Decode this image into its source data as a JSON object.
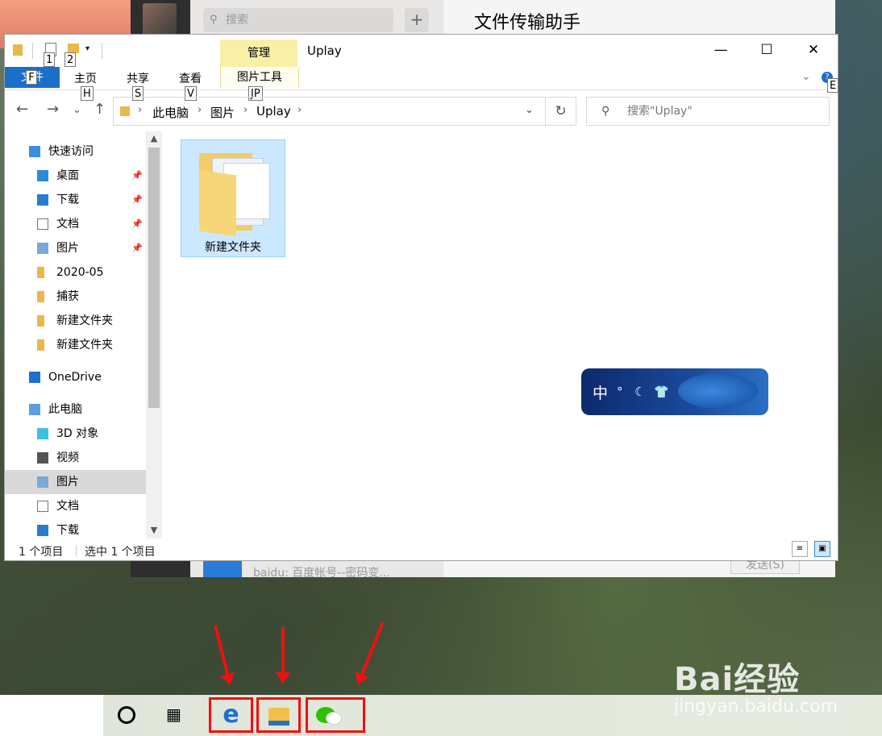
{
  "background_app": {
    "search_placeholder": "搜索",
    "plus": "+",
    "chat_title": "文件传输助手",
    "preview_text": "baidu: 百度帐号--密码变...",
    "send_button": "发送(S)"
  },
  "window": {
    "title": "Uplay",
    "context_tab": "管理",
    "quick_access_keytips": [
      "1",
      "2"
    ],
    "controls": {
      "minimize": "—",
      "maximize": "☐",
      "close": "✕"
    }
  },
  "ribbon": {
    "file_tab": "文件",
    "tabs": [
      "主页",
      "共享",
      "查看"
    ],
    "tools_tab": "图片工具",
    "keytips": {
      "file": "F",
      "home": "H",
      "share": "S",
      "view": "V",
      "tools": "JP",
      "help": "E"
    },
    "collapse": "⌄",
    "help": "?"
  },
  "navigation": {
    "back": "←",
    "forward": "→",
    "recent": "⌄",
    "up": "↑",
    "breadcrumb": [
      "此电脑",
      "图片",
      "Uplay"
    ],
    "search_placeholder": "搜索\"Uplay\""
  },
  "nav_pane": {
    "items": [
      {
        "label": "快速访问",
        "icon": "star-icon",
        "pinned": false
      },
      {
        "label": "桌面",
        "icon": "desktop-icon",
        "pinned": true
      },
      {
        "label": "下载",
        "icon": "download-icon",
        "pinned": true
      },
      {
        "label": "文档",
        "icon": "document-icon",
        "pinned": true
      },
      {
        "label": "图片",
        "icon": "pictures-icon",
        "pinned": true
      },
      {
        "label": "2020-05",
        "icon": "folder-icon",
        "pinned": false
      },
      {
        "label": "捕获",
        "icon": "folder-icon",
        "pinned": false
      },
      {
        "label": "新建文件夹",
        "icon": "folder-icon",
        "pinned": false
      },
      {
        "label": "新建文件夹",
        "icon": "folder-icon",
        "pinned": false
      },
      {
        "label": "OneDrive",
        "icon": "cloud-icon",
        "pinned": false
      },
      {
        "label": "此电脑",
        "icon": "computer-icon",
        "pinned": false
      },
      {
        "label": "3D 对象",
        "icon": "cube-icon",
        "pinned": false
      },
      {
        "label": "视频",
        "icon": "video-icon",
        "pinned": false
      },
      {
        "label": "图片",
        "icon": "pictures-icon",
        "pinned": false,
        "selected": true
      },
      {
        "label": "文档",
        "icon": "document-icon",
        "pinned": false
      },
      {
        "label": "下载",
        "icon": "download-icon",
        "pinned": false
      }
    ]
  },
  "content": {
    "items": [
      {
        "label": "新建文件夹",
        "type": "folder",
        "selected": true
      }
    ]
  },
  "ime": {
    "mode": "中",
    "symbols": [
      "°",
      "☾",
      "👕"
    ]
  },
  "status": {
    "item_count": "1 个项目",
    "selected_count": "选中 1 个项目"
  },
  "taskbar": {
    "apps": [
      "edge-icon",
      "file-explorer-icon",
      "wechat-icon"
    ],
    "edge_glyph": "e"
  },
  "watermark": {
    "logo": "Bai经验",
    "url": "jingyan.baidu.com"
  },
  "colors": {
    "accent": "#1a6fc8",
    "selection": "#cce8ff",
    "manage_tab": "#f9f0a8",
    "highlight_arrows": "#ee1111"
  }
}
